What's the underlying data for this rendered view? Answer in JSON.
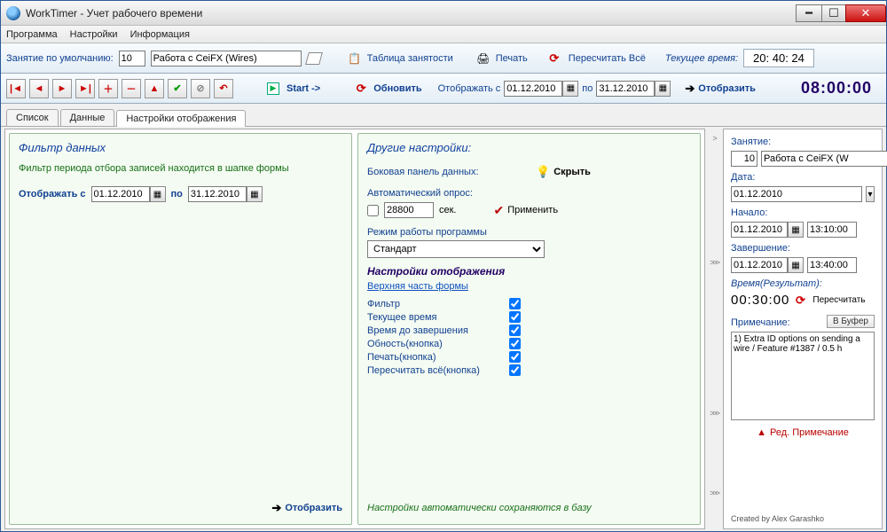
{
  "title": "WorkTimer - Учет рабочего времени",
  "menu": {
    "program": "Программа",
    "settings": "Настройки",
    "info": "Информация"
  },
  "toolbar": {
    "default_task_label": "Занятие по умолчанию:",
    "default_task_id": "10",
    "default_task_name": "Работа с CeiFX (Wires)",
    "busy_table": "Таблица занятости",
    "print": "Печать",
    "recalc_all": "Пересчитать Всё",
    "current_time_label": "Текущее время:",
    "current_time": "20: 40: 24"
  },
  "toolbar2": {
    "start": "Start ->",
    "refresh": "Обновить",
    "display_from_label": "Отображать с",
    "date_from": "01.12.2010",
    "to_label": "по",
    "date_to": "31.12.2010",
    "display_btn": "Отобразить",
    "big_time": "08:00:00"
  },
  "tabs": {
    "list": "Список",
    "data": "Данные",
    "display_settings": "Настройки отображения"
  },
  "filter_panel": {
    "title": "Фильтр данных",
    "hint": "Фильтр периода отбора записей находится в шапке формы",
    "display_from": "Отображать с",
    "date_from": "01.12.2010",
    "to": "по",
    "date_to": "31.12.2010",
    "display_btn": "Отобразить"
  },
  "other_panel": {
    "title": "Другие настройки:",
    "side_panel_label": "Боковая панель данных:",
    "hide": "Скрыть",
    "auto_poll_label": "Автоматический опрос:",
    "auto_poll_value": "28800",
    "sec": "сек.",
    "apply": "Применить",
    "mode_label": "Режим работы программы",
    "mode_value": "Стандарт",
    "display_settings_title": "Настройки отображения",
    "top_form": "Верхняя часть формы",
    "rows": {
      "filter": "Фильтр",
      "current_time": "Текущее время",
      "time_to_end": "Время до завершения",
      "refresh_btn": "Обность(кнопка)",
      "print_btn": "Печать(кнопка)",
      "recalc_btn": "Пересчитать всё(кнопка)"
    },
    "autosave_hint": "Настройки автоматически сохраняются в базу"
  },
  "sidebar": {
    "task_label": "Занятие:",
    "task_id": "10",
    "task_name": "Работа с CeiFX (W",
    "date_label": "Дата:",
    "date": "01.12.2010",
    "start_label": "Начало:",
    "start_date": "01.12.2010",
    "start_time": "13:10:00",
    "end_label": "Завершение:",
    "end_date": "01.12.2010",
    "end_time": "13:40:00",
    "result_label": "Время(Результат):",
    "result_time": "00:30:00",
    "recalc": "Пересчитать",
    "note_label": "Примечание:",
    "to_buffer": "В Буфер",
    "notes_text": "1) Extra ID options on sending a wire / Feature #1387 / 0.5 h",
    "edit_note": "Ред. Примечание",
    "footer": "Created by Alex Garashko"
  }
}
